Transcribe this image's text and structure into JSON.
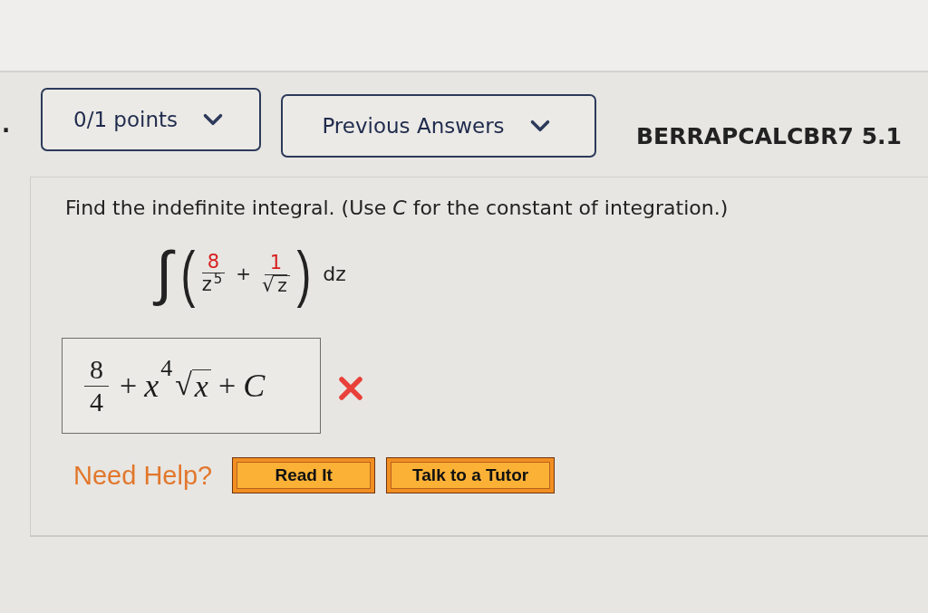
{
  "question_number": ".",
  "header": {
    "points": {
      "label": "0/1 points"
    },
    "previous_answers": {
      "label": "Previous Answers"
    },
    "code": "BERRAPCALCBR7 5.1"
  },
  "question": {
    "instruction": "Find the indefinite integral. (Use *C* for the constant of integration.)",
    "integral": {
      "integral_sign": "∫",
      "open_paren": "(",
      "terms": [
        {
          "kind": "power_fraction",
          "numerator": "8",
          "highlighted": true,
          "base": "z",
          "exponent": "5"
        },
        {
          "kind": "operator",
          "text": "+"
        },
        {
          "kind": "root_fraction",
          "numerator": "1",
          "highlighted": true,
          "radical": "√",
          "radicand": "z"
        }
      ],
      "close_paren": ")",
      "differential": "dz"
    },
    "answer": {
      "correct": false,
      "terms": [
        {
          "kind": "fraction",
          "numerator": "8",
          "denominator": "4"
        },
        {
          "kind": "operator",
          "text": "+"
        },
        {
          "kind": "power",
          "base": "x",
          "exponent": "4"
        },
        {
          "kind": "root",
          "radical": "√",
          "radicand": "x"
        },
        {
          "kind": "operator",
          "text": "+"
        },
        {
          "kind": "variable",
          "text": "C"
        }
      ]
    }
  },
  "help": {
    "label": "Need Help?",
    "buttons": [
      "Read It",
      "Talk to a Tutor"
    ]
  }
}
